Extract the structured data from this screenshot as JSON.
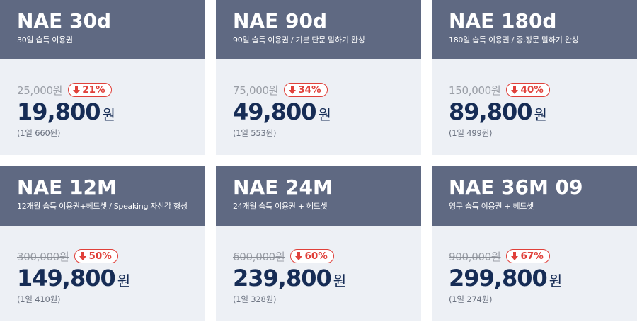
{
  "colors": {
    "header_bg": "#5f6982",
    "body_bg": "#edf0f5",
    "price": "#162c55",
    "discount": "#e0403a",
    "original_price": "#9a9ea6"
  },
  "cards": [
    {
      "title": "NAE 30d",
      "subtitle": "30일 습득 이용권",
      "original_price": "25,000원",
      "discount": "21%",
      "price": "19,800",
      "currency": "원",
      "per_day": "(1일 660원)"
    },
    {
      "title": "NAE 90d",
      "subtitle": "90일 습득 이용권 / 기본 단문 말하기 완성",
      "original_price": "75,000원",
      "discount": "34%",
      "price": "49,800",
      "currency": "원",
      "per_day": "(1일 553원)"
    },
    {
      "title": "NAE 180d",
      "subtitle": "180일 습득 이용권 / 중,장문 말하기 완성",
      "original_price": "150,000원",
      "discount": "40%",
      "price": "89,800",
      "currency": "원",
      "per_day": "(1일 499원)"
    },
    {
      "title": "NAE 12M",
      "subtitle": "12개월 습득 이용권+헤드셋 / Speaking 자신감 형성",
      "original_price": "300,000원",
      "discount": "50%",
      "price": "149,800",
      "currency": "원",
      "per_day": "(1일 410원)"
    },
    {
      "title": "NAE 24M",
      "subtitle": "24개월 습득 이용권 + 헤드셋",
      "original_price": "600,000원",
      "discount": "60%",
      "price": "239,800",
      "currency": "원",
      "per_day": "(1일 328원)"
    },
    {
      "title": "NAE 36M 09",
      "subtitle": "영구 습득 이용권 + 헤드셋",
      "original_price": "900,000원",
      "discount": "67%",
      "price": "299,800",
      "currency": "원",
      "per_day": "(1일 274원)"
    }
  ]
}
